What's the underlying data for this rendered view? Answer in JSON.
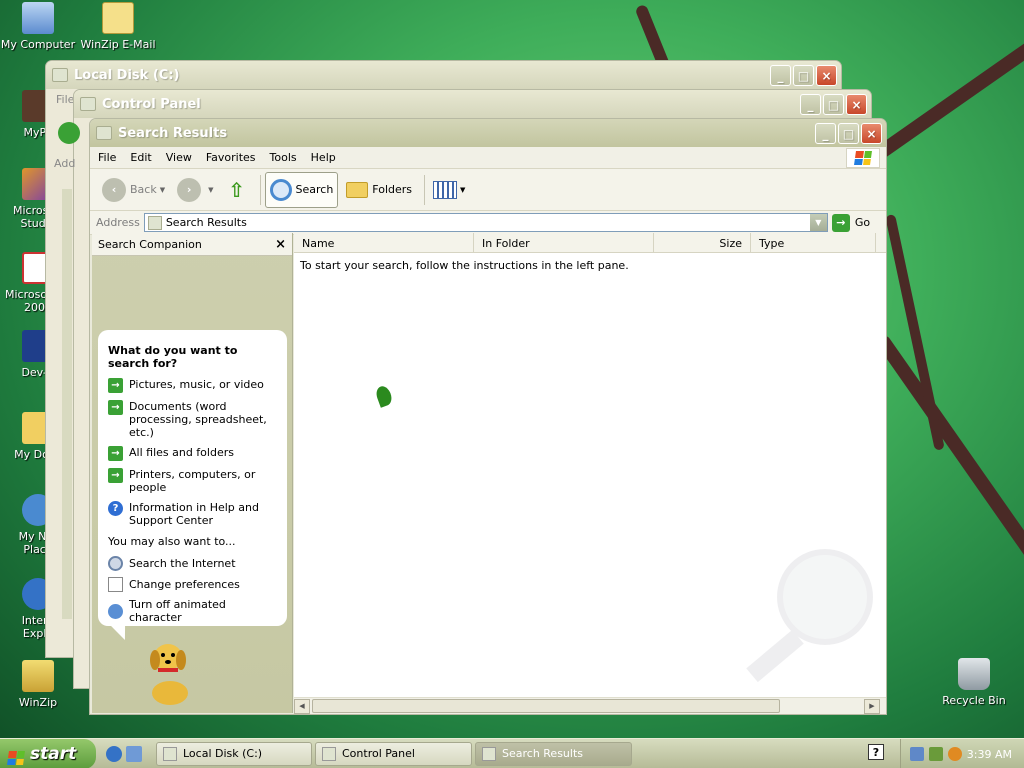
{
  "desktop": {
    "icons": [
      {
        "label": "My Computer"
      },
      {
        "label": "WinZip E-Mail Companion"
      },
      {
        "label": "MyPa"
      },
      {
        "label": "Microsoft Studio"
      },
      {
        "label": "Microsoft J# 2005"
      },
      {
        "label": "Dev-C"
      },
      {
        "label": "My Docu"
      },
      {
        "label": "My Net Place"
      },
      {
        "label": "Intern Explo"
      },
      {
        "label": "WinZip"
      },
      {
        "label": "Recycle Bin"
      }
    ]
  },
  "windows": {
    "back1": {
      "title": "Local Disk (C:)",
      "menu_fragment": "File"
    },
    "back2": {
      "title": "Control Panel",
      "side_fragment": "Add"
    }
  },
  "main": {
    "title": "Search Results",
    "menu": [
      "File",
      "Edit",
      "View",
      "Favorites",
      "Tools",
      "Help"
    ],
    "toolbar": {
      "back": "Back",
      "search": "Search",
      "folders": "Folders"
    },
    "address": {
      "label": "Address",
      "value": "Search Results",
      "go": "Go"
    },
    "companion": {
      "header": "Search Companion",
      "question": "What do you want to search for?",
      "options": [
        "Pictures, music, or video",
        "Documents (word processing, spreadsheet, etc.)",
        "All files and folders",
        "Printers, computers, or people",
        "Information in Help and Support Center"
      ],
      "also_heading": "You may also want to...",
      "also": [
        "Search the Internet",
        "Change preferences",
        "Turn off animated character"
      ]
    },
    "columns": [
      "Name",
      "In Folder",
      "Size",
      "Type"
    ],
    "message": "To start your search, follow the instructions in the left pane."
  },
  "taskbar": {
    "start": "start",
    "tasks": [
      "Local Disk (C:)",
      "Control Panel",
      "Search Results"
    ],
    "clock": "3:39 AM"
  },
  "colors": {
    "accent_green": "#3aa135",
    "title_inactive": "#c8cba8"
  }
}
